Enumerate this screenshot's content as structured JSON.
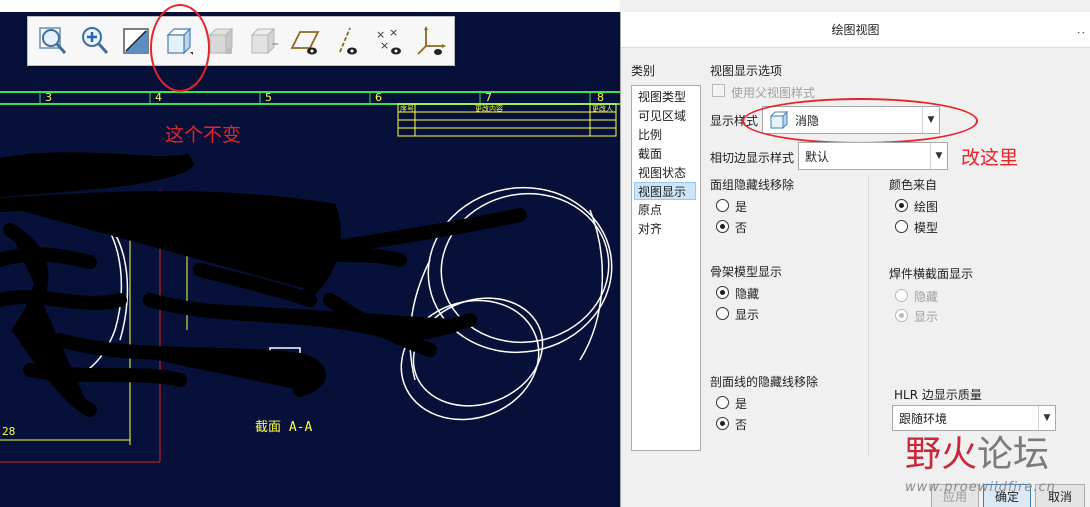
{
  "cad": {
    "ruler_numbers": [
      "3",
      "4",
      "5",
      "6",
      "7",
      "8"
    ],
    "annotation_unchanged": "这个不变",
    "table_headers": [
      "序号",
      "更改内容",
      "更改人"
    ],
    "section_label": "截面 A-A",
    "dim_value": "28"
  },
  "toolbar": {
    "buttons": [
      {
        "icon": "zoom-fit-icon"
      },
      {
        "icon": "zoom-in-icon"
      },
      {
        "icon": "repaint-icon"
      },
      {
        "icon": "hidden-display-style-icon"
      },
      {
        "icon": "shading-icon"
      },
      {
        "icon": "shading-edges-icon"
      },
      {
        "icon": "plane-display-icon"
      },
      {
        "icon": "axis-display-icon"
      },
      {
        "icon": "point-display-icon"
      },
      {
        "icon": "csys-display-icon"
      }
    ]
  },
  "dialog": {
    "title": "绘图视图",
    "categories_label": "类别",
    "categories": [
      "视图类型",
      "可见区域",
      "比例",
      "截面",
      "视图状态",
      "视图显示",
      "原点",
      "对齐"
    ],
    "selected_category": "视图显示",
    "section_title": "视图显示选项",
    "use_parent_style": "使用父视图样式",
    "display_style_label": "显示样式",
    "display_style_value": "消隐",
    "tangent_edge_label": "相切边显示样式",
    "tangent_edge_value": "默认",
    "annotation_change_here": "改这里",
    "face_group_hidden_label": "面组隐藏线移除",
    "face_group_options": [
      "是",
      "否"
    ],
    "face_group_selected": "否",
    "color_from_label": "颜色来自",
    "color_from_options": [
      "绘图",
      "模型"
    ],
    "color_from_selected": "绘图",
    "skeleton_label": "骨架模型显示",
    "skeleton_options": [
      "隐藏",
      "显示"
    ],
    "skeleton_selected": "隐藏",
    "weld_label": "焊件横截面显示",
    "weld_options": [
      "隐藏",
      "显示"
    ],
    "weld_selected": "显示",
    "section_hidden_label": "剖面线的隐藏线移除",
    "section_hidden_options": [
      "是",
      "否"
    ],
    "section_hidden_selected": "否",
    "hlr_label": "HLR 边显示质量",
    "hlr_value": "跟随环境",
    "buttons": {
      "apply": "应用",
      "ok": "确定",
      "cancel": "取消"
    }
  },
  "watermark": {
    "title_wild": "野火",
    "title_forum": "论坛",
    "url": "www.proewildfire.cn"
  },
  "colors": {
    "cad_background": "#061038",
    "annotation_red": "#e8232a",
    "cad_yellow": "#ffff40"
  }
}
